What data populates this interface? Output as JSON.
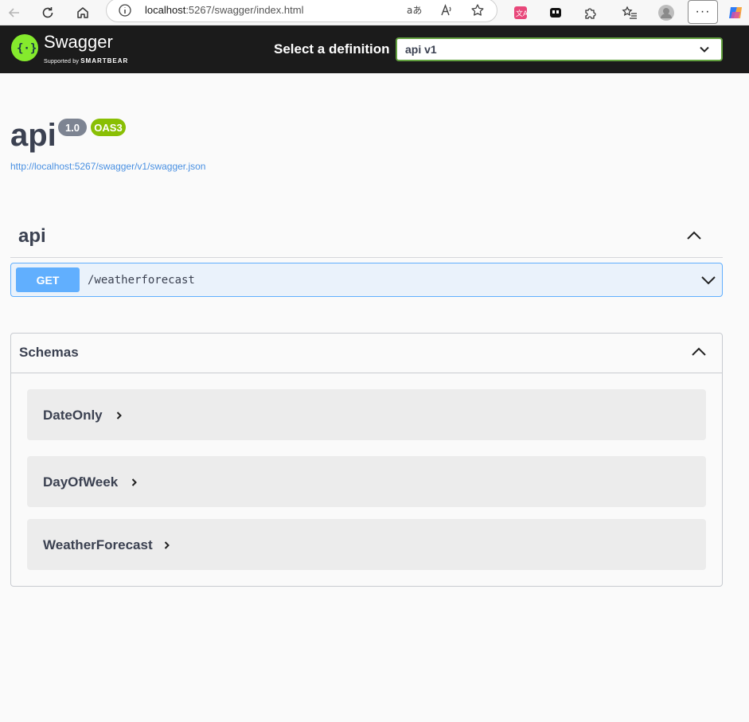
{
  "browser": {
    "url_host": "localhost",
    "url_rest": ":5267/swagger/index.html",
    "more_label": "···"
  },
  "topbar": {
    "logo_text": "Swagger",
    "logo_supported": "Supported by",
    "logo_company": "SMARTBEAR",
    "select_label": "Select a definition",
    "selected_definition": "api v1"
  },
  "info": {
    "title": "api",
    "version": "1.0",
    "oas": "OAS3",
    "spec_url": "http://localhost:5267/swagger/v1/swagger.json"
  },
  "tag": {
    "name": "api",
    "operations": [
      {
        "method": "GET",
        "path": "/weatherforecast"
      }
    ]
  },
  "schemas": {
    "title": "Schemas",
    "models": [
      {
        "name": "DateOnly"
      },
      {
        "name": "DayOfWeek"
      },
      {
        "name": "WeatherForecast"
      }
    ]
  },
  "colors": {
    "topbar_bg": "#1b1b1b",
    "accent_green": "#62a03f",
    "get_blue": "#61affe",
    "oas_badge": "#89bf04",
    "version_badge": "#7d8492",
    "link": "#4990e2"
  }
}
